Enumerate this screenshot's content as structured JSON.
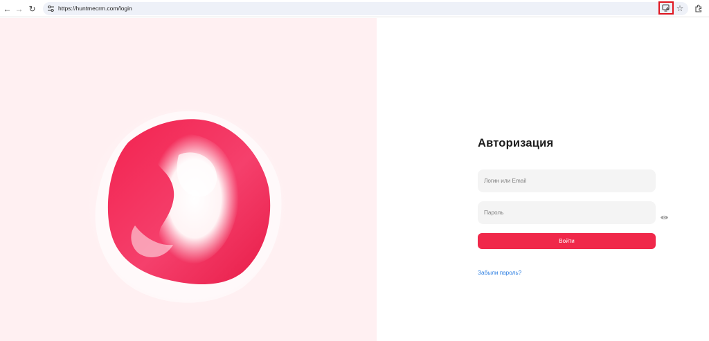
{
  "browser": {
    "url": "https://huntmecrm.com/login",
    "back_icon": "←",
    "forward_icon": "→",
    "reload_icon": "↻",
    "star_icon": "☆"
  },
  "login": {
    "title": "Авторизация",
    "login_placeholder": "Логин или Email",
    "password_placeholder": "Пароль",
    "submit_label": "Войти",
    "forgot_link": "Забыли пароль?"
  },
  "theme": {
    "accent": "#f0284a",
    "left_background": "#fff0f2",
    "link": "#2a7de1"
  }
}
